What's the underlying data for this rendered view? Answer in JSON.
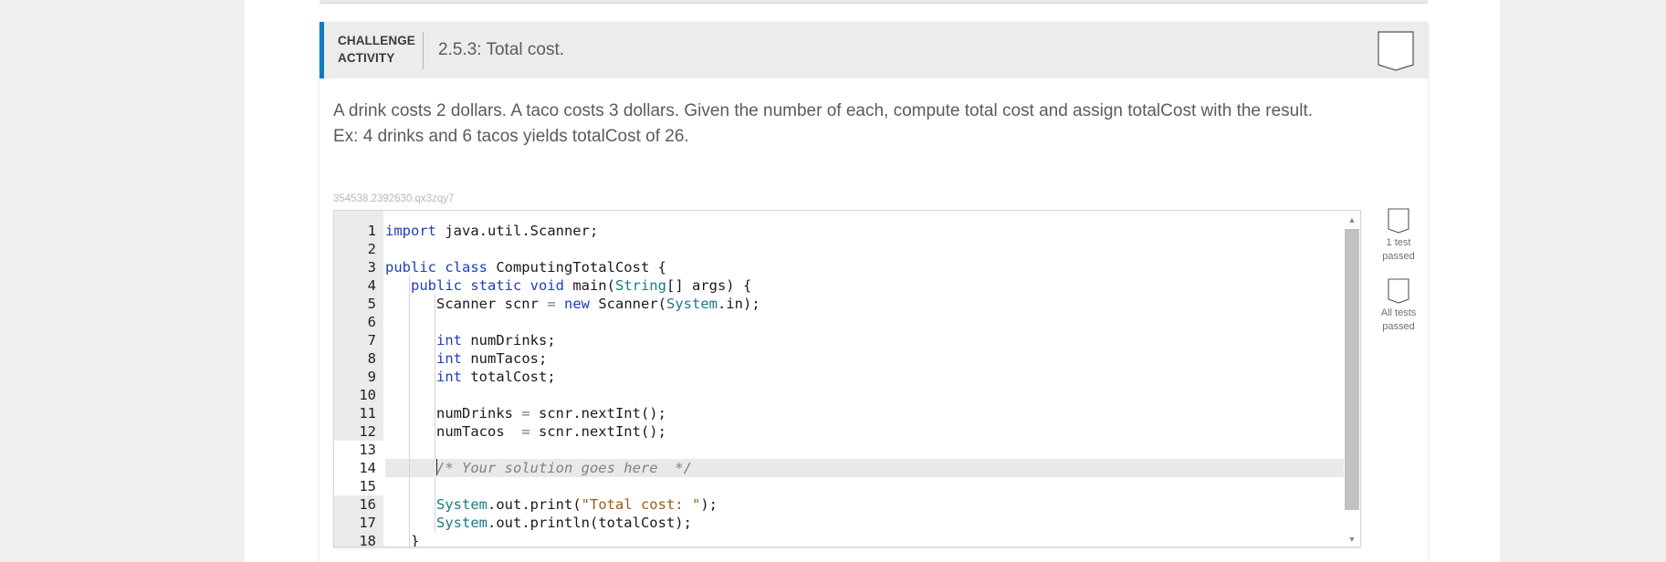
{
  "activity": {
    "type_label_line1": "CHALLENGE",
    "type_label_line2": "ACTIVITY",
    "title": "2.5.3: Total cost.",
    "prompt_line1": "A drink costs 2 dollars. A taco costs 3 dollars. Given the number of each, compute total cost and assign totalCost with the result.",
    "prompt_line2": "Ex: 4 drinks and 6 tacos yields totalCost of 26.",
    "id": "354538.2392630.qx3zqy7"
  },
  "code_lines": [
    {
      "n": "1",
      "segs": [
        {
          "t": "kw",
          "v": "import"
        },
        {
          "t": "",
          "v": " java.util.Scanner;"
        }
      ]
    },
    {
      "n": "2",
      "segs": []
    },
    {
      "n": "3",
      "segs": [
        {
          "t": "kw",
          "v": "public class"
        },
        {
          "t": "",
          "v": " ComputingTotalCost {"
        }
      ]
    },
    {
      "n": "4",
      "indent": 1,
      "segs": [
        {
          "t": "",
          "v": "   "
        },
        {
          "t": "kw",
          "v": "public static void"
        },
        {
          "t": "",
          "v": " main("
        },
        {
          "t": "ty",
          "v": "String"
        },
        {
          "t": "",
          "v": "[] args) {"
        }
      ]
    },
    {
      "n": "5",
      "indent": 2,
      "segs": [
        {
          "t": "",
          "v": "      Scanner scnr "
        },
        {
          "t": "op",
          "v": "="
        },
        {
          "t": "",
          "v": " "
        },
        {
          "t": "kw",
          "v": "new"
        },
        {
          "t": "",
          "v": " Scanner("
        },
        {
          "t": "ty",
          "v": "System"
        },
        {
          "t": "",
          "v": ".in);"
        }
      ]
    },
    {
      "n": "6",
      "indent": 2,
      "segs": []
    },
    {
      "n": "7",
      "indent": 2,
      "segs": [
        {
          "t": "",
          "v": "      "
        },
        {
          "t": "kw",
          "v": "int"
        },
        {
          "t": "",
          "v": " numDrinks;"
        }
      ]
    },
    {
      "n": "8",
      "indent": 2,
      "segs": [
        {
          "t": "",
          "v": "      "
        },
        {
          "t": "kw",
          "v": "int"
        },
        {
          "t": "",
          "v": " numTacos;"
        }
      ]
    },
    {
      "n": "9",
      "indent": 2,
      "segs": [
        {
          "t": "",
          "v": "      "
        },
        {
          "t": "kw",
          "v": "int"
        },
        {
          "t": "",
          "v": " totalCost;"
        }
      ]
    },
    {
      "n": "10",
      "indent": 2,
      "segs": []
    },
    {
      "n": "11",
      "indent": 2,
      "segs": [
        {
          "t": "",
          "v": "      numDrinks "
        },
        {
          "t": "op",
          "v": "="
        },
        {
          "t": "",
          "v": " scnr.nextInt();"
        }
      ]
    },
    {
      "n": "12",
      "indent": 2,
      "segs": [
        {
          "t": "",
          "v": "      numTacos  "
        },
        {
          "t": "op",
          "v": "="
        },
        {
          "t": "",
          "v": " scnr.nextInt();"
        }
      ]
    },
    {
      "n": "13",
      "editable": true,
      "indent": 2,
      "segs": []
    },
    {
      "n": "14",
      "editable": true,
      "active": true,
      "cursor": true,
      "indent": 1,
      "segs": [
        {
          "t": "",
          "v": "      "
        },
        {
          "t": "cm",
          "v": "/* Your solution goes here  */"
        }
      ]
    },
    {
      "n": "15",
      "editable": true,
      "indent": 2,
      "segs": []
    },
    {
      "n": "16",
      "indent": 2,
      "segs": [
        {
          "t": "",
          "v": "      "
        },
        {
          "t": "ty",
          "v": "System"
        },
        {
          "t": "",
          "v": ".out.print("
        },
        {
          "t": "str",
          "v": "\"Total cost: \""
        },
        {
          "t": "",
          "v": ");"
        }
      ]
    },
    {
      "n": "17",
      "indent": 2,
      "segs": [
        {
          "t": "",
          "v": "      "
        },
        {
          "t": "ty",
          "v": "System"
        },
        {
          "t": "",
          "v": ".out.println(totalCost);"
        }
      ]
    },
    {
      "n": "18",
      "indent": 1,
      "segs": [
        {
          "t": "",
          "v": "   }"
        }
      ]
    }
  ],
  "status": {
    "test1_line1": "1 test",
    "test1_line2": "passed",
    "all_line1": "All tests",
    "all_line2": "passed"
  },
  "colors": {
    "accent": "#0a7bc4",
    "keyword": "#1d3fba",
    "type": "#1b7a82",
    "string": "#9b5a16"
  }
}
